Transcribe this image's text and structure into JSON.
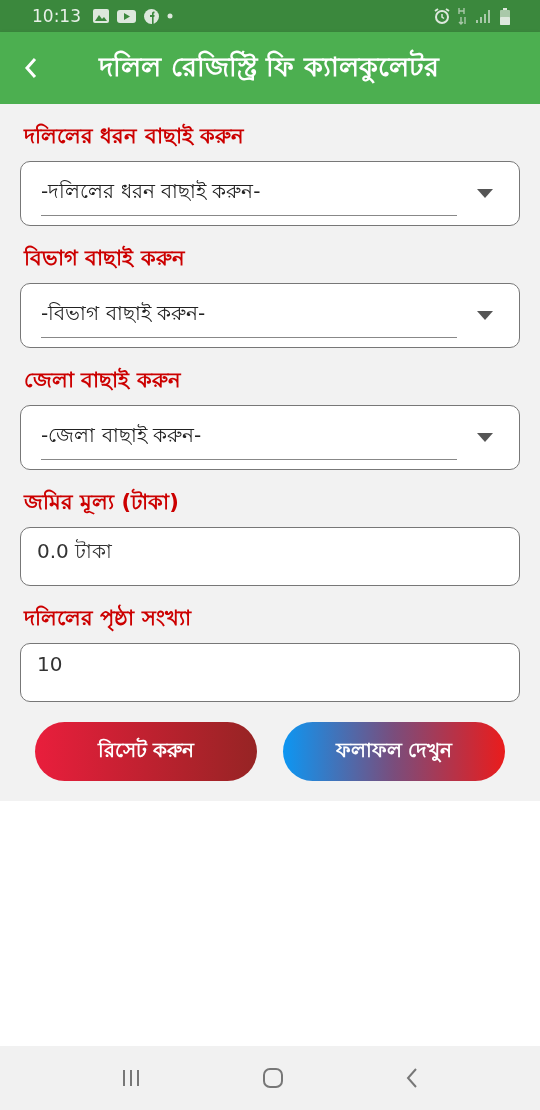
{
  "status_bar": {
    "time": "10:13"
  },
  "app_bar": {
    "title": "দলিল রেজিস্ট্রি ফি ক্যালকুলেটর"
  },
  "fields": [
    {
      "kind": "dropdown",
      "label": "দলিলের ধরন বাছাই করুন",
      "value": "-দলিলের ধরন বাছাই করুন-"
    },
    {
      "kind": "dropdown",
      "label": "বিভাগ বাছাই করুন",
      "value": "-বিভাগ বাছাই করুন-"
    },
    {
      "kind": "dropdown",
      "label": "জেলা বাছাই করুন",
      "value": "-জেলা বাছাই করুন-"
    },
    {
      "kind": "input",
      "label": "জমির মূল্য (টাকা)",
      "value": "0.0 টাকা"
    },
    {
      "kind": "input",
      "label": "দলিলের পৃষ্ঠা সংখ্যা",
      "value": "10"
    }
  ],
  "buttons": [
    {
      "kind": "reset",
      "label": "রিসেট করুন"
    },
    {
      "kind": "result",
      "label": "ফলাফল দেখুন"
    }
  ]
}
